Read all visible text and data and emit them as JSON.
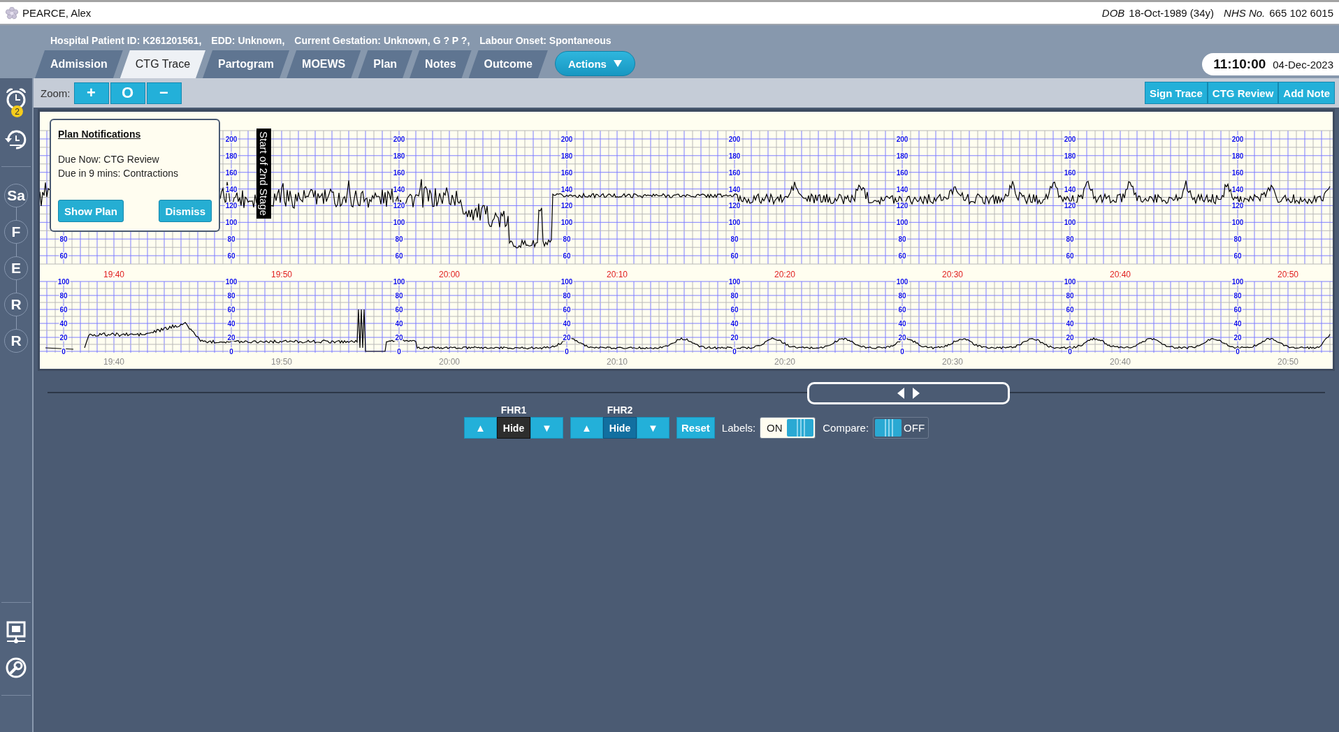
{
  "patient": {
    "name": "PEARCE, Alex",
    "dob_label": "DOB",
    "dob": "18-Oct-1989 (34y)",
    "nhs_label": "NHS No.",
    "nhs": "665 102 6015"
  },
  "summary": [
    "Hospital Patient ID: K261201561,",
    "EDD: Unknown,",
    "Current Gestation: Unknown, G ? P ?,",
    "Labour Onset: Spontaneous"
  ],
  "tabs": [
    {
      "label": "Admission",
      "selected": false
    },
    {
      "label": "CTG Trace",
      "selected": true
    },
    {
      "label": "Partogram",
      "selected": false
    },
    {
      "label": "MOEWS",
      "selected": false
    },
    {
      "label": "Plan",
      "selected": false
    },
    {
      "label": "Notes",
      "selected": false
    },
    {
      "label": "Outcome",
      "selected": false
    }
  ],
  "actions": {
    "label": "Actions"
  },
  "clock": {
    "time": "11:10:00",
    "date": "04-Dec-2023"
  },
  "zoom": {
    "label": "Zoom:",
    "buttons": [
      "+",
      "O",
      "−"
    ]
  },
  "toolbar_buttons": [
    "Sign Trace",
    "CTG Review",
    "Add Note"
  ],
  "sidebar": {
    "alarm_badge": "2",
    "stages": [
      "Sa",
      "F",
      "E",
      "R",
      "R"
    ]
  },
  "notification": {
    "title": "Plan Notifications",
    "lines": [
      "Due Now: CTG Review",
      "Due in 9 mins: Contractions"
    ],
    "buttons": [
      "Show Plan",
      "Dismiss"
    ]
  },
  "ctg": {
    "annotation": "Start of 2nd Stage",
    "segments": [
      {
        "fhr_ticks": [
          "80",
          "60"
        ],
        "fhr_time": "19:40",
        "toco_ticks": [
          "100",
          "80",
          "60",
          "40",
          "20",
          "0"
        ],
        "toco_time": "19:40"
      },
      {
        "fhr_ticks": [
          "200",
          "180",
          "160",
          "140",
          "120",
          "100",
          "80",
          "60"
        ],
        "fhr_time": "19:50",
        "toco_ticks": [
          "100",
          "80",
          "60",
          "40",
          "20",
          "0"
        ],
        "toco_time": "19:50"
      },
      {
        "fhr_ticks": [
          "200",
          "180",
          "160",
          "140",
          "120",
          "100",
          "80",
          "60"
        ],
        "fhr_time": "20:00",
        "toco_ticks": [
          "100",
          "80",
          "60",
          "40",
          "20",
          "0"
        ],
        "toco_time": "20:00"
      },
      {
        "fhr_ticks": [
          "200",
          "180",
          "160",
          "140",
          "120",
          "100",
          "80",
          "60"
        ],
        "fhr_time": "20:10",
        "toco_ticks": [
          "100",
          "80",
          "60",
          "40",
          "20",
          "0"
        ],
        "toco_time": "20:10"
      },
      {
        "fhr_ticks": [
          "200",
          "180",
          "160",
          "140",
          "120",
          "100",
          "80",
          "60"
        ],
        "fhr_time": "20:20",
        "toco_ticks": [
          "100",
          "80",
          "60",
          "40",
          "20",
          "0"
        ],
        "toco_time": "20:20"
      },
      {
        "fhr_ticks": [
          "200",
          "180",
          "160",
          "140",
          "120",
          "100",
          "80",
          "60"
        ],
        "fhr_time": "20:30",
        "toco_ticks": [
          "100",
          "80",
          "60",
          "40",
          "20",
          "0"
        ],
        "toco_time": "20:30"
      },
      {
        "fhr_ticks": [
          "200",
          "180",
          "160",
          "140",
          "120",
          "100",
          "80",
          "60"
        ],
        "fhr_time": "20:40",
        "toco_ticks": [
          "100",
          "80",
          "60",
          "40",
          "20",
          "0"
        ],
        "toco_time": "20:40"
      },
      {
        "fhr_ticks": [
          "200",
          "180",
          "160",
          "140",
          "120",
          "100",
          "80",
          "60"
        ],
        "fhr_time": "20:50",
        "toco_ticks": [
          "100",
          "80",
          "60",
          "40",
          "20",
          "0"
        ],
        "toco_time": "20:50"
      }
    ]
  },
  "controls": {
    "channels": [
      {
        "label": "FHR1",
        "up": "▲",
        "hide": "Hide",
        "down": "▼",
        "active": true
      },
      {
        "label": "FHR2",
        "up": "▲",
        "hide": "Hide",
        "down": "▼",
        "active": false
      }
    ],
    "reset": "Reset",
    "toggles": [
      {
        "label": "Labels:",
        "state_text": "ON",
        "on": true
      },
      {
        "label": "Compare:",
        "state_text": "OFF",
        "on": false
      }
    ]
  }
}
